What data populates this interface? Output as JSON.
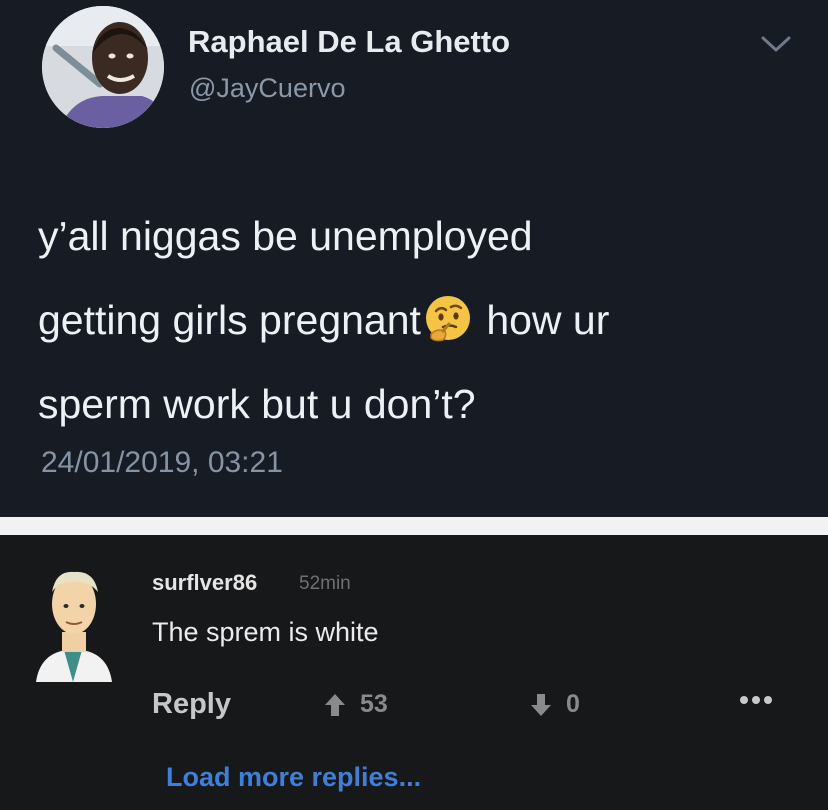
{
  "tweet": {
    "author_name": "Raphael De La Ghetto",
    "author_handle": "@JayCuervo",
    "text_line1": "y’all niggas be unemployed",
    "text_line2a": "getting girls pregnant",
    "text_line2b": " how ur",
    "text_line3": "sperm work but u don’t?",
    "emoji": "thinking-face",
    "timestamp": "24/01/2019, 03:21"
  },
  "comment": {
    "username": "surflver86",
    "time": "52min",
    "text": "The sprem is white",
    "reply_label": "Reply",
    "upvotes": "53",
    "downvotes": "0",
    "load_more_label": "Load more replies..."
  },
  "colors": {
    "tweet_bg": "#161b24",
    "comment_bg": "#17181a",
    "link": "#3f7fd8"
  }
}
